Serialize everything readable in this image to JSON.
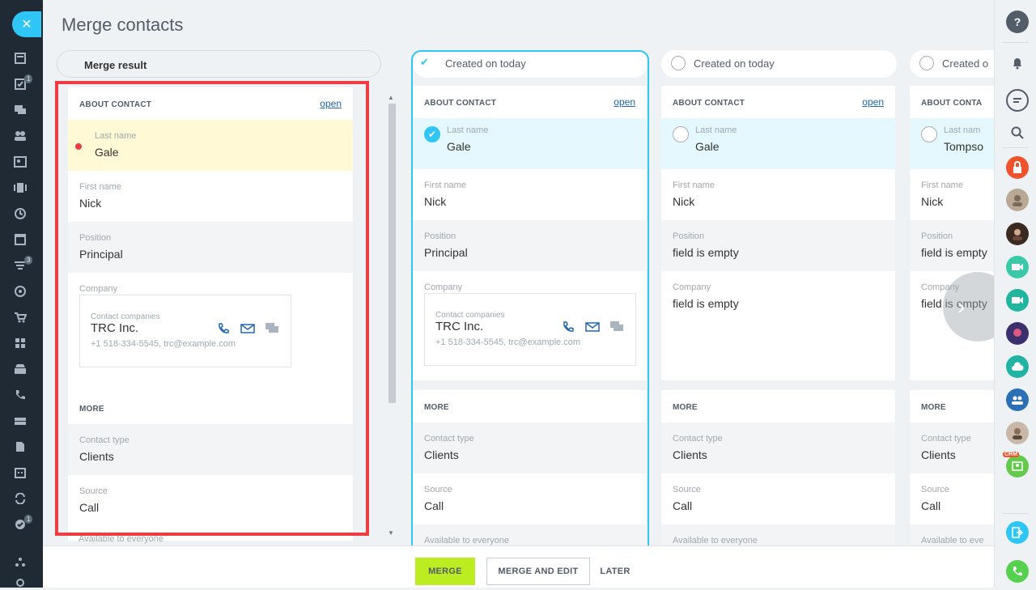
{
  "page": {
    "title": "Merge contacts"
  },
  "merge_result": {
    "header": "Merge result",
    "about_title": "ABOUT CONTACT",
    "open_label": "open",
    "fields": [
      {
        "label": "Last name",
        "value": "Gale"
      },
      {
        "label": "First name",
        "value": "Nick"
      },
      {
        "label": "Position",
        "value": "Principal"
      }
    ],
    "company": {
      "label": "Company",
      "box_label": "Contact companies",
      "name": "TRC Inc.",
      "meta": "+1 518-334-5545, trc@example.com"
    },
    "more_title": "MORE",
    "more_fields": [
      {
        "label": "Contact type",
        "value": "Clients"
      },
      {
        "label": "Source",
        "value": "Call"
      }
    ],
    "available_label": "Available to everyone"
  },
  "columns": [
    {
      "header": "Created on today",
      "selected": true,
      "about_title": "ABOUT CONTACT",
      "open_label": "open",
      "last_name": {
        "label": "Last name",
        "value": "Gale"
      },
      "first_name": {
        "label": "First name",
        "value": "Nick"
      },
      "position": {
        "label": "Position",
        "value": "Principal"
      },
      "company": {
        "label": "Company",
        "box_label": "Contact companies",
        "name": "TRC Inc.",
        "meta": "+1 518-334-5545, trc@example.com"
      },
      "more_title": "MORE",
      "contact_type": {
        "label": "Contact type",
        "value": "Clients"
      },
      "source": {
        "label": "Source",
        "value": "Call"
      },
      "available_label": "Available to everyone"
    },
    {
      "header": "Created on today",
      "selected": false,
      "about_title": "ABOUT CONTACT",
      "open_label": "open",
      "last_name": {
        "label": "Last name",
        "value": "Gale"
      },
      "first_name": {
        "label": "First name",
        "value": "Nick"
      },
      "position": {
        "label": "Position",
        "value": "field is empty"
      },
      "company": {
        "label": "Company",
        "value": "field is empty"
      },
      "more_title": "MORE",
      "contact_type": {
        "label": "Contact type",
        "value": "Clients"
      },
      "source": {
        "label": "Source",
        "value": "Call"
      },
      "available_label": "Available to everyone"
    },
    {
      "header": "Created o",
      "selected": false,
      "about_title": "ABOUT CONTA",
      "last_name": {
        "label": "Last nam",
        "value": "Tompso"
      },
      "first_name": {
        "label": "First name",
        "value": "Nick"
      },
      "position": {
        "label": "Position",
        "value": "field is empty"
      },
      "company": {
        "label": "Company",
        "value": "field is empty"
      },
      "more_title": "MORE",
      "contact_type": {
        "label": "Contact type",
        "value": "Clients"
      },
      "source": {
        "label": "Source",
        "value": "Call"
      },
      "available_label": "Available to eve"
    }
  ],
  "footer": {
    "merge": "MERGE",
    "merge_and_edit": "MERGE AND EDIT",
    "later": "LATER"
  },
  "left_badges": {
    "tasks": "1",
    "filter": "3",
    "bottom": "1"
  },
  "right_bar": {
    "help_icon": "question-icon",
    "crm_badge": "CRM"
  },
  "colors": {
    "accent": "#2fc6f6",
    "merge_button": "#bbed21",
    "highlight_frame": "#ef3c42",
    "field_highlight": "#fffad5"
  }
}
